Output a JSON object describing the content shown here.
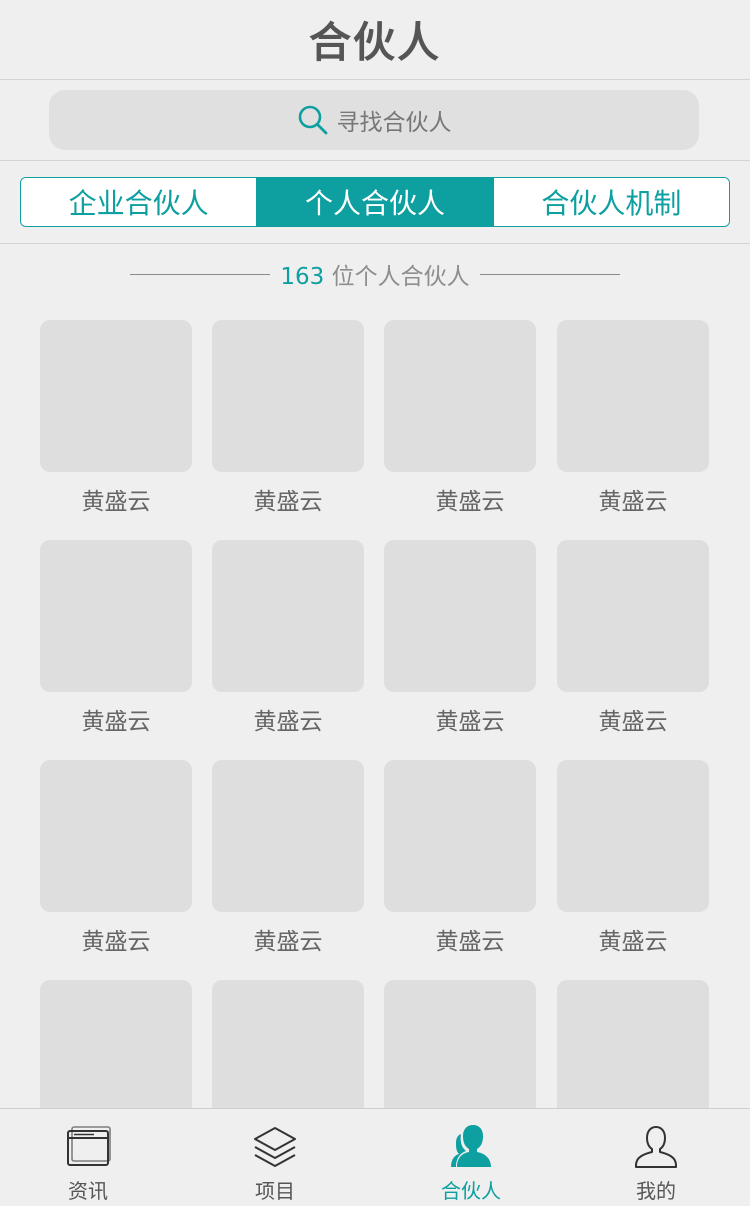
{
  "header": {
    "title": "合伙人"
  },
  "search": {
    "placeholder": "寻找合伙人",
    "icon": "search-icon"
  },
  "tabs": [
    {
      "label": "企业合伙人",
      "active": false
    },
    {
      "label": "个人合伙人",
      "active": true
    },
    {
      "label": "合伙人机制",
      "active": false
    }
  ],
  "summary": {
    "count": "163",
    "label": "位个人合伙人"
  },
  "partners": [
    {
      "name": "黄盛云"
    },
    {
      "name": "黄盛云"
    },
    {
      "name": "黄盛云"
    },
    {
      "name": "黄盛云"
    },
    {
      "name": "黄盛云"
    },
    {
      "name": "黄盛云"
    },
    {
      "name": "黄盛云"
    },
    {
      "name": "黄盛云"
    },
    {
      "name": "黄盛云"
    },
    {
      "name": "黄盛云"
    },
    {
      "name": "黄盛云"
    },
    {
      "name": "黄盛云"
    },
    {
      "name": ""
    },
    {
      "name": ""
    },
    {
      "name": ""
    },
    {
      "name": ""
    }
  ],
  "tabbar": [
    {
      "label": "资讯",
      "icon": "news-icon",
      "active": false
    },
    {
      "label": "项目",
      "icon": "layers-icon",
      "active": false
    },
    {
      "label": "合伙人",
      "icon": "partners-icon",
      "active": true
    },
    {
      "label": "我的",
      "icon": "profile-icon",
      "active": false
    }
  ],
  "colors": {
    "accent": "#0e9fa0",
    "background": "#efefef",
    "placeholder": "#dedede"
  }
}
